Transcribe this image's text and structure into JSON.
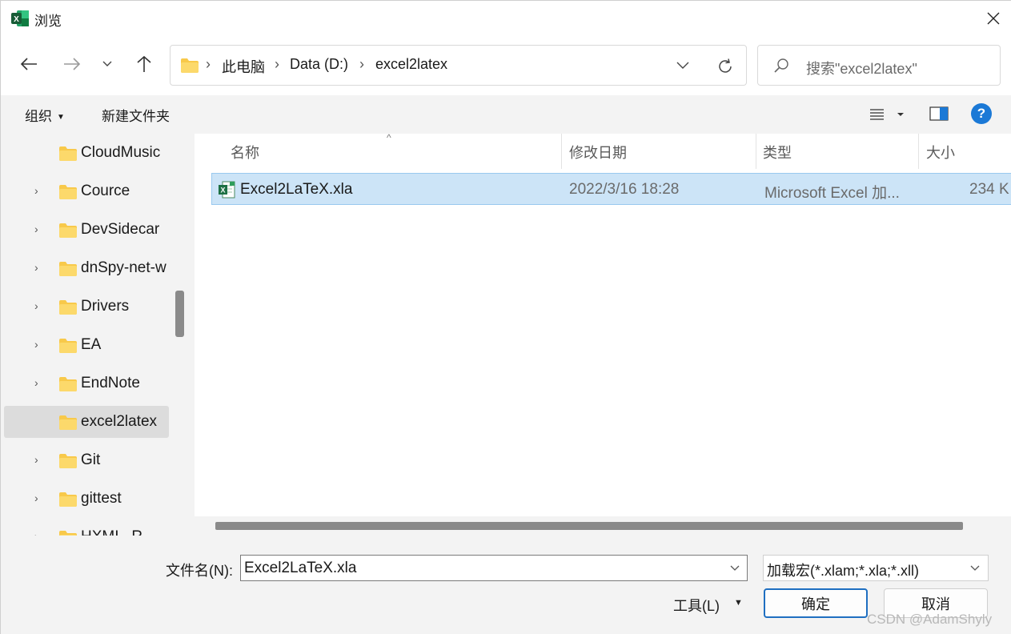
{
  "window": {
    "title": "浏览",
    "app_icon": "excel-icon",
    "close_icon": "close-icon"
  },
  "nav": {
    "back_icon": "arrow-left-icon",
    "forward_icon": "arrow-right-icon",
    "recent_icon": "chevron-down-icon",
    "up_icon": "arrow-up-icon"
  },
  "address": {
    "folder_icon": "folder-icon",
    "crumbs": [
      "此电脑",
      "Data (D:)",
      "excel2latex"
    ],
    "separator": "›",
    "dropdown_icon": "chevron-down-icon",
    "refresh_icon": "refresh-icon"
  },
  "search": {
    "icon": "search-icon",
    "placeholder": "搜索\"excel2latex\""
  },
  "toolbar": {
    "organize": "组织",
    "organize_caret": "▼",
    "new_folder": "新建文件夹",
    "view_icon": "view-list-icon",
    "preview_pane_icon": "preview-pane-icon",
    "help": "?"
  },
  "navpane": {
    "items": [
      {
        "label": "CloudMusic",
        "expandable": false,
        "selected": false
      },
      {
        "label": "Cource",
        "expandable": true,
        "selected": false
      },
      {
        "label": "DevSidecar",
        "expandable": true,
        "selected": false
      },
      {
        "label": "dnSpy-net-w",
        "expandable": true,
        "selected": false
      },
      {
        "label": "Drivers",
        "expandable": true,
        "selected": false
      },
      {
        "label": "EA",
        "expandable": true,
        "selected": false
      },
      {
        "label": "EndNote",
        "expandable": true,
        "selected": false
      },
      {
        "label": "excel2latex",
        "expandable": false,
        "selected": true
      },
      {
        "label": "Git",
        "expandable": true,
        "selected": false
      },
      {
        "label": "gittest",
        "expandable": true,
        "selected": false
      },
      {
        "label": "HXMI...R...",
        "expandable": true,
        "selected": false
      }
    ],
    "chevron": "›"
  },
  "filelist": {
    "columns": [
      "名称",
      "修改日期",
      "类型",
      "大小"
    ],
    "sort_indicator": "^",
    "rows": [
      {
        "name": "Excel2LaTeX.xla",
        "modified": "2022/3/16 18:28",
        "type": "Microsoft Excel 加...",
        "size": "234 K",
        "icon": "excel-addin-icon",
        "selected": true
      }
    ]
  },
  "bottom": {
    "filename_label": "文件名(N):",
    "filename_value": "Excel2LaTeX.xla",
    "filetype_value": "加载宏(*.xlam;*.xla;*.xll)",
    "tools_label": "工具(L)",
    "tools_caret": "▼",
    "ok_label": "确定",
    "cancel_label": "取消"
  },
  "watermark": "CSDN @AdamShyly",
  "colors": {
    "selection_bg": "#cce4f7",
    "selection_border": "#99c9ef",
    "accent": "#1b79d6",
    "folder_yellow": "#f8c94a"
  }
}
